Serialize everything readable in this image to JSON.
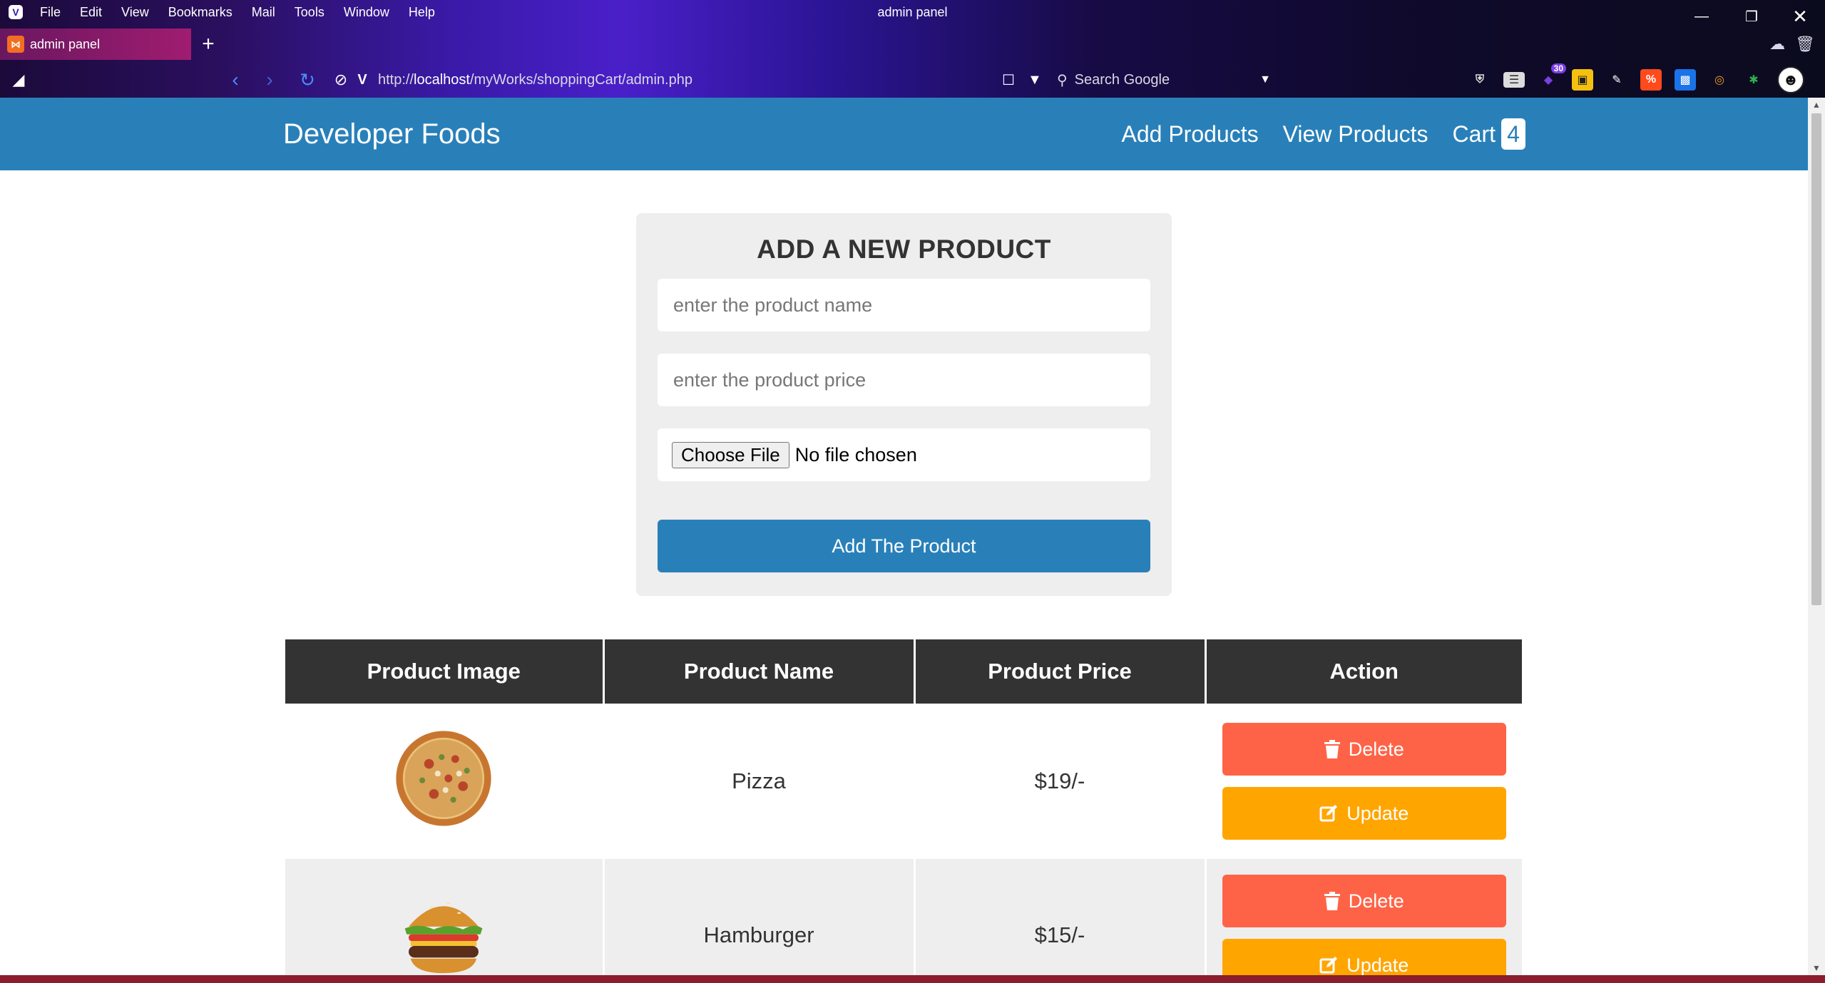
{
  "browser": {
    "menu": [
      "File",
      "Edit",
      "View",
      "Bookmarks",
      "Mail",
      "Tools",
      "Window",
      "Help"
    ],
    "window_title": "admin panel",
    "tab_title": "admin panel",
    "url_prefix": "http://",
    "url_host": "localhost",
    "url_path": "/myWorks/shoppingCart/admin.php",
    "search_placeholder": "Search Google",
    "extension_badge": "30"
  },
  "header": {
    "logo": "Developer Foods",
    "nav": [
      "Add Products",
      "View Products",
      "Cart"
    ],
    "cart_count": "4"
  },
  "form": {
    "title": "ADD A NEW PRODUCT",
    "name_placeholder": "enter the product name",
    "price_placeholder": "enter the product price",
    "file_button": "Choose File",
    "file_status": "No file chosen",
    "submit_label": "Add The Product"
  },
  "table": {
    "headers": [
      "Product Image",
      "Product Name",
      "Product Price",
      "Action"
    ],
    "rows": [
      {
        "image": "pizza-image",
        "name": "Pizza",
        "price": "$19/-",
        "delete": "Delete",
        "update": "Update"
      },
      {
        "image": "hamburger-image",
        "name": "Hamburger",
        "price": "$15/-",
        "delete": "Delete",
        "update": "Update"
      }
    ]
  },
  "colors": {
    "primary": "#2980b9",
    "delete": "#ff6347",
    "update": "#ffa500",
    "table_header": "#333333"
  }
}
